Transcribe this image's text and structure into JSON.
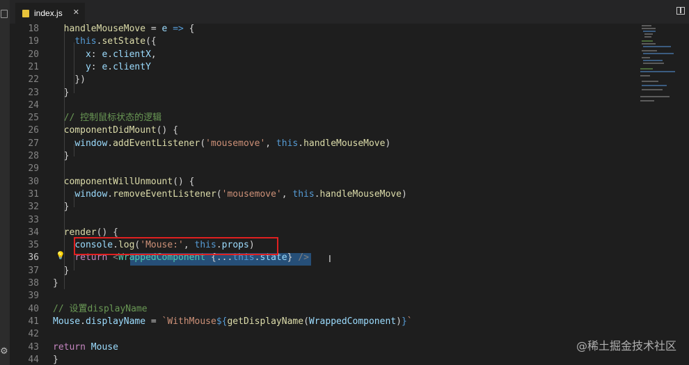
{
  "tab": {
    "label": "index.js",
    "close": "✕"
  },
  "lines": [
    {
      "n": "18",
      "tokens": [
        [
          "  handleMouseMove",
          "fn"
        ],
        [
          " = ",
          "plain"
        ],
        [
          "e",
          "var"
        ],
        [
          " ",
          "plain"
        ],
        [
          "=>",
          "kw"
        ],
        [
          " {",
          "plain"
        ]
      ]
    },
    {
      "n": "19",
      "tokens": [
        [
          "    ",
          "plain"
        ],
        [
          "this",
          "kw"
        ],
        [
          ".",
          "plain"
        ],
        [
          "setState",
          "fn"
        ],
        [
          "({",
          "plain"
        ]
      ]
    },
    {
      "n": "20",
      "tokens": [
        [
          "      ",
          "plain"
        ],
        [
          "x",
          "var"
        ],
        [
          ": ",
          "plain"
        ],
        [
          "e",
          "var"
        ],
        [
          ".",
          "plain"
        ],
        [
          "clientX",
          "var"
        ],
        [
          ",",
          "plain"
        ]
      ]
    },
    {
      "n": "21",
      "tokens": [
        [
          "      ",
          "plain"
        ],
        [
          "y",
          "var"
        ],
        [
          ": ",
          "plain"
        ],
        [
          "e",
          "var"
        ],
        [
          ".",
          "plain"
        ],
        [
          "clientY",
          "var"
        ]
      ]
    },
    {
      "n": "22",
      "tokens": [
        [
          "    })",
          "plain"
        ]
      ]
    },
    {
      "n": "23",
      "tokens": [
        [
          "  }",
          "plain"
        ]
      ]
    },
    {
      "n": "24",
      "tokens": []
    },
    {
      "n": "25",
      "tokens": [
        [
          "  // 控制鼠标状态的逻辑",
          "cmt"
        ]
      ]
    },
    {
      "n": "26",
      "tokens": [
        [
          "  ",
          "plain"
        ],
        [
          "componentDidMount",
          "fn"
        ],
        [
          "() {",
          "plain"
        ]
      ]
    },
    {
      "n": "27",
      "tokens": [
        [
          "    ",
          "plain"
        ],
        [
          "window",
          "var"
        ],
        [
          ".",
          "plain"
        ],
        [
          "addEventListener",
          "fn"
        ],
        [
          "(",
          "plain"
        ],
        [
          "'mousemove'",
          "str"
        ],
        [
          ", ",
          "plain"
        ],
        [
          "this",
          "kw"
        ],
        [
          ".",
          "plain"
        ],
        [
          "handleMouseMove",
          "fn"
        ],
        [
          ")",
          "plain"
        ]
      ]
    },
    {
      "n": "28",
      "tokens": [
        [
          "  }",
          "plain"
        ]
      ]
    },
    {
      "n": "29",
      "tokens": []
    },
    {
      "n": "30",
      "tokens": [
        [
          "  ",
          "plain"
        ],
        [
          "componentWillUnmount",
          "fn"
        ],
        [
          "() {",
          "plain"
        ]
      ]
    },
    {
      "n": "31",
      "tokens": [
        [
          "    ",
          "plain"
        ],
        [
          "window",
          "var"
        ],
        [
          ".",
          "plain"
        ],
        [
          "removeEventListener",
          "fn"
        ],
        [
          "(",
          "plain"
        ],
        [
          "'mousemove'",
          "str"
        ],
        [
          ", ",
          "plain"
        ],
        [
          "this",
          "kw"
        ],
        [
          ".",
          "plain"
        ],
        [
          "handleMouseMove",
          "fn"
        ],
        [
          ")",
          "plain"
        ]
      ]
    },
    {
      "n": "32",
      "tokens": [
        [
          "  }",
          "plain"
        ]
      ]
    },
    {
      "n": "33",
      "tokens": []
    },
    {
      "n": "34",
      "tokens": [
        [
          "  ",
          "plain"
        ],
        [
          "render",
          "fn"
        ],
        [
          "() {",
          "plain"
        ]
      ]
    },
    {
      "n": "35",
      "tokens": [
        [
          "    ",
          "plain"
        ],
        [
          "console",
          "var"
        ],
        [
          ".",
          "plain"
        ],
        [
          "log",
          "fn"
        ],
        [
          "(",
          "plain"
        ],
        [
          "'Mouse:'",
          "str"
        ],
        [
          ", ",
          "plain"
        ],
        [
          "this",
          "kw"
        ],
        [
          ".",
          "plain"
        ],
        [
          "props",
          "var"
        ],
        [
          ")",
          "plain"
        ]
      ]
    },
    {
      "n": "36",
      "tokens": [
        [
          "    ",
          "plain"
        ],
        [
          "return",
          "ctrl"
        ],
        [
          " ",
          "plain"
        ],
        [
          "<",
          "jsxbr"
        ],
        [
          "WrappedComponent",
          "jsxtag"
        ],
        [
          " {...",
          "plain"
        ],
        [
          "this",
          "kw"
        ],
        [
          ".",
          "plain"
        ],
        [
          "state",
          "var"
        ],
        [
          "} ",
          "plain"
        ],
        [
          "/>",
          "jsxbr"
        ]
      ]
    },
    {
      "n": "37",
      "tokens": [
        [
          "  }",
          "plain"
        ]
      ]
    },
    {
      "n": "38",
      "tokens": [
        [
          "}",
          "plain"
        ]
      ]
    },
    {
      "n": "39",
      "tokens": []
    },
    {
      "n": "40",
      "tokens": [
        [
          "// 设置displayName",
          "cmt"
        ]
      ]
    },
    {
      "n": "41",
      "tokens": [
        [
          "Mouse",
          "var"
        ],
        [
          ".",
          "plain"
        ],
        [
          "displayName",
          "var"
        ],
        [
          " = ",
          "plain"
        ],
        [
          "`WithMouse",
          "str"
        ],
        [
          "${",
          "kw"
        ],
        [
          "getDisplayName",
          "fn"
        ],
        [
          "(",
          "plain"
        ],
        [
          "WrappedComponent",
          "var"
        ],
        [
          ")",
          "plain"
        ],
        [
          "}",
          "kw"
        ],
        [
          "`",
          "str"
        ]
      ]
    },
    {
      "n": "42",
      "tokens": []
    },
    {
      "n": "43",
      "tokens": [
        [
          "return",
          "ctrl"
        ],
        [
          " ",
          "plain"
        ],
        [
          "Mouse",
          "var"
        ]
      ]
    },
    {
      "n": "44",
      "tokens": [
        [
          "}",
          "plain"
        ]
      ]
    }
  ],
  "active_line": "36",
  "watermark": "@稀土掘金技术社区",
  "icons": {
    "file": "js-file-icon",
    "split": "split-editor-icon",
    "bulb": "lightbulb-icon",
    "cursor": "text-cursor-icon"
  }
}
